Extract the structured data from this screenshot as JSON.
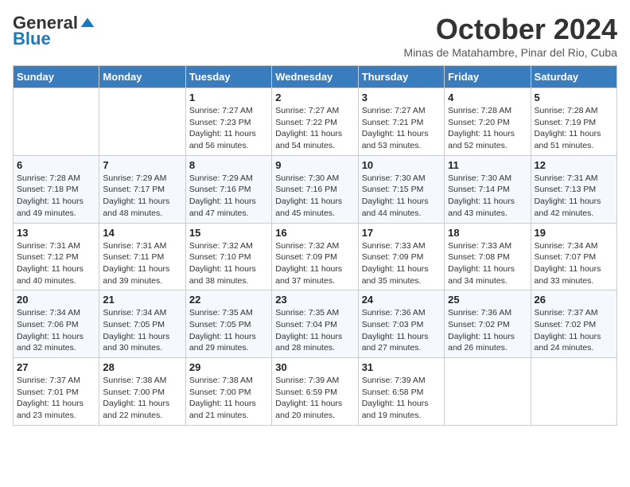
{
  "header": {
    "logo_general": "General",
    "logo_blue": "Blue",
    "month_title": "October 2024",
    "subtitle": "Minas de Matahambre, Pinar del Rio, Cuba"
  },
  "days_of_week": [
    "Sunday",
    "Monday",
    "Tuesday",
    "Wednesday",
    "Thursday",
    "Friday",
    "Saturday"
  ],
  "weeks": [
    [
      {
        "day": "",
        "info": ""
      },
      {
        "day": "",
        "info": ""
      },
      {
        "day": "1",
        "info": "Sunrise: 7:27 AM\nSunset: 7:23 PM\nDaylight: 11 hours and 56 minutes."
      },
      {
        "day": "2",
        "info": "Sunrise: 7:27 AM\nSunset: 7:22 PM\nDaylight: 11 hours and 54 minutes."
      },
      {
        "day": "3",
        "info": "Sunrise: 7:27 AM\nSunset: 7:21 PM\nDaylight: 11 hours and 53 minutes."
      },
      {
        "day": "4",
        "info": "Sunrise: 7:28 AM\nSunset: 7:20 PM\nDaylight: 11 hours and 52 minutes."
      },
      {
        "day": "5",
        "info": "Sunrise: 7:28 AM\nSunset: 7:19 PM\nDaylight: 11 hours and 51 minutes."
      }
    ],
    [
      {
        "day": "6",
        "info": "Sunrise: 7:28 AM\nSunset: 7:18 PM\nDaylight: 11 hours and 49 minutes."
      },
      {
        "day": "7",
        "info": "Sunrise: 7:29 AM\nSunset: 7:17 PM\nDaylight: 11 hours and 48 minutes."
      },
      {
        "day": "8",
        "info": "Sunrise: 7:29 AM\nSunset: 7:16 PM\nDaylight: 11 hours and 47 minutes."
      },
      {
        "day": "9",
        "info": "Sunrise: 7:30 AM\nSunset: 7:16 PM\nDaylight: 11 hours and 45 minutes."
      },
      {
        "day": "10",
        "info": "Sunrise: 7:30 AM\nSunset: 7:15 PM\nDaylight: 11 hours and 44 minutes."
      },
      {
        "day": "11",
        "info": "Sunrise: 7:30 AM\nSunset: 7:14 PM\nDaylight: 11 hours and 43 minutes."
      },
      {
        "day": "12",
        "info": "Sunrise: 7:31 AM\nSunset: 7:13 PM\nDaylight: 11 hours and 42 minutes."
      }
    ],
    [
      {
        "day": "13",
        "info": "Sunrise: 7:31 AM\nSunset: 7:12 PM\nDaylight: 11 hours and 40 minutes."
      },
      {
        "day": "14",
        "info": "Sunrise: 7:31 AM\nSunset: 7:11 PM\nDaylight: 11 hours and 39 minutes."
      },
      {
        "day": "15",
        "info": "Sunrise: 7:32 AM\nSunset: 7:10 PM\nDaylight: 11 hours and 38 minutes."
      },
      {
        "day": "16",
        "info": "Sunrise: 7:32 AM\nSunset: 7:09 PM\nDaylight: 11 hours and 37 minutes."
      },
      {
        "day": "17",
        "info": "Sunrise: 7:33 AM\nSunset: 7:09 PM\nDaylight: 11 hours and 35 minutes."
      },
      {
        "day": "18",
        "info": "Sunrise: 7:33 AM\nSunset: 7:08 PM\nDaylight: 11 hours and 34 minutes."
      },
      {
        "day": "19",
        "info": "Sunrise: 7:34 AM\nSunset: 7:07 PM\nDaylight: 11 hours and 33 minutes."
      }
    ],
    [
      {
        "day": "20",
        "info": "Sunrise: 7:34 AM\nSunset: 7:06 PM\nDaylight: 11 hours and 32 minutes."
      },
      {
        "day": "21",
        "info": "Sunrise: 7:34 AM\nSunset: 7:05 PM\nDaylight: 11 hours and 30 minutes."
      },
      {
        "day": "22",
        "info": "Sunrise: 7:35 AM\nSunset: 7:05 PM\nDaylight: 11 hours and 29 minutes."
      },
      {
        "day": "23",
        "info": "Sunrise: 7:35 AM\nSunset: 7:04 PM\nDaylight: 11 hours and 28 minutes."
      },
      {
        "day": "24",
        "info": "Sunrise: 7:36 AM\nSunset: 7:03 PM\nDaylight: 11 hours and 27 minutes."
      },
      {
        "day": "25",
        "info": "Sunrise: 7:36 AM\nSunset: 7:02 PM\nDaylight: 11 hours and 26 minutes."
      },
      {
        "day": "26",
        "info": "Sunrise: 7:37 AM\nSunset: 7:02 PM\nDaylight: 11 hours and 24 minutes."
      }
    ],
    [
      {
        "day": "27",
        "info": "Sunrise: 7:37 AM\nSunset: 7:01 PM\nDaylight: 11 hours and 23 minutes."
      },
      {
        "day": "28",
        "info": "Sunrise: 7:38 AM\nSunset: 7:00 PM\nDaylight: 11 hours and 22 minutes."
      },
      {
        "day": "29",
        "info": "Sunrise: 7:38 AM\nSunset: 7:00 PM\nDaylight: 11 hours and 21 minutes."
      },
      {
        "day": "30",
        "info": "Sunrise: 7:39 AM\nSunset: 6:59 PM\nDaylight: 11 hours and 20 minutes."
      },
      {
        "day": "31",
        "info": "Sunrise: 7:39 AM\nSunset: 6:58 PM\nDaylight: 11 hours and 19 minutes."
      },
      {
        "day": "",
        "info": ""
      },
      {
        "day": "",
        "info": ""
      }
    ]
  ]
}
